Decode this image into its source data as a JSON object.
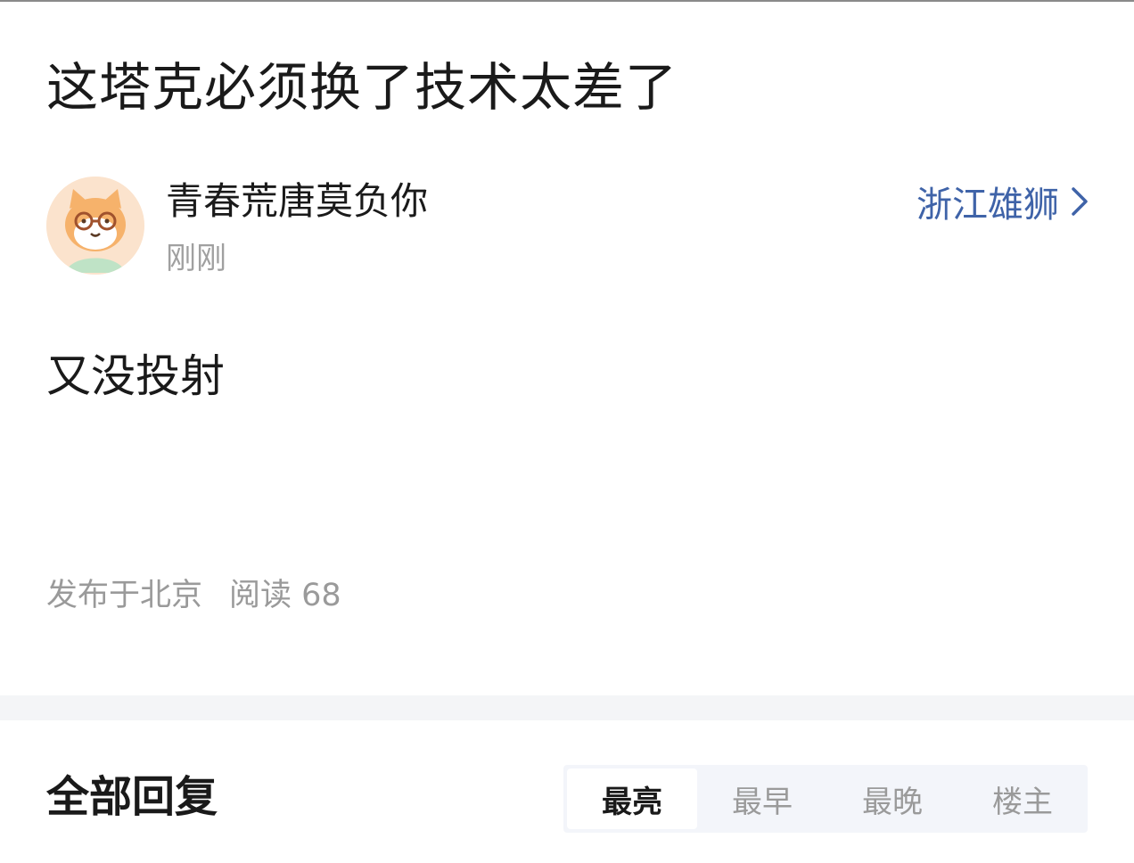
{
  "post": {
    "title": "这塔克必须换了技术太差了",
    "body": "又没投射"
  },
  "author": {
    "name": "青春荒唐莫负你",
    "time": "刚刚",
    "avatar_icon": "cartoon-cat-avatar"
  },
  "team": {
    "label": "浙江雄狮",
    "icon": "chevron-right-icon",
    "color": "#3f63a8"
  },
  "meta": {
    "location": "发布于北京",
    "reads": "阅读 68"
  },
  "replies": {
    "heading": "全部回复",
    "sort_tabs": [
      {
        "label": "最亮",
        "active": true
      },
      {
        "label": "最早",
        "active": false
      },
      {
        "label": "最晚",
        "active": false
      },
      {
        "label": "楼主",
        "active": false
      }
    ]
  }
}
